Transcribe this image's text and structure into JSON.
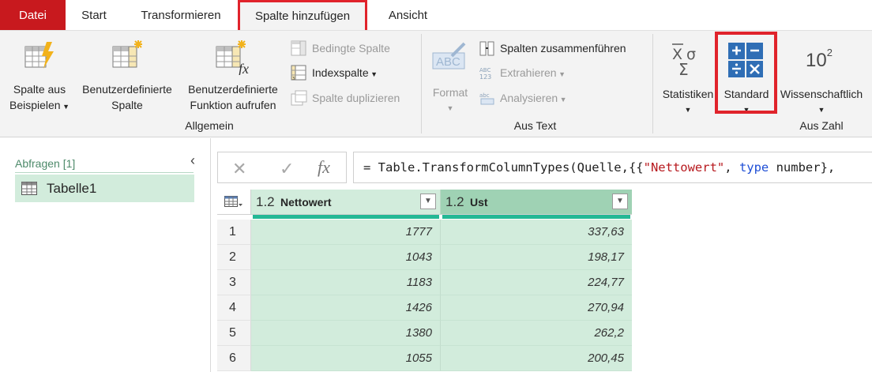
{
  "tabs": {
    "file": "Datei",
    "start": "Start",
    "transform": "Transformieren",
    "add_column": "Spalte hinzufügen",
    "view": "Ansicht"
  },
  "ribbon": {
    "allgemein": {
      "label": "Allgemein",
      "column_from_examples": [
        "Spalte aus",
        "Beispielen"
      ],
      "custom_column": [
        "Benutzerdefinierte",
        "Spalte"
      ],
      "custom_function": [
        "Benutzerdefinierte",
        "Funktion aufrufen"
      ],
      "conditional_column": "Bedingte Spalte",
      "index_column": "Indexspalte",
      "duplicate_column": "Spalte duplizieren"
    },
    "aus_text": {
      "label": "Aus Text",
      "format": "Format",
      "merge_columns": "Spalten zusammenführen",
      "extract": "Extrahieren",
      "parse": "Analysieren"
    },
    "aus_zahl": {
      "label": "Aus Zahl",
      "statistics": "Statistiken",
      "standard": "Standard",
      "scientific": "Wissenschaftlich",
      "scientific_icon_text": "10",
      "scientific_icon_exp": "2"
    }
  },
  "queries": {
    "header": "Abfragen [1]",
    "items": [
      "Tabelle1"
    ]
  },
  "formula": {
    "prefix": "= Table.TransformColumnTypes(Quelle,{{",
    "str1": "\"Nettowert\"",
    "sep": ", ",
    "kw": "type",
    "rest": " number},"
  },
  "grid": {
    "columns": [
      {
        "type": "1.2",
        "name": "Nettowert"
      },
      {
        "type": "1.2",
        "name": "Ust"
      }
    ],
    "rows": [
      {
        "n": "1",
        "nettowert": "1777",
        "ust": "337,63"
      },
      {
        "n": "2",
        "nettowert": "1043",
        "ust": "198,17"
      },
      {
        "n": "3",
        "nettowert": "1183",
        "ust": "224,77"
      },
      {
        "n": "4",
        "nettowert": "1426",
        "ust": "270,94"
      },
      {
        "n": "5",
        "nettowert": "1380",
        "ust": "262,2"
      },
      {
        "n": "6",
        "nettowert": "1055",
        "ust": "200,45"
      }
    ]
  },
  "colors": {
    "file_tab": "#c8191e",
    "highlight": "#e0232b",
    "selected_column": "#9fd2b4",
    "column_bg": "#d2ecdc",
    "quality_bar": "#24b895"
  }
}
